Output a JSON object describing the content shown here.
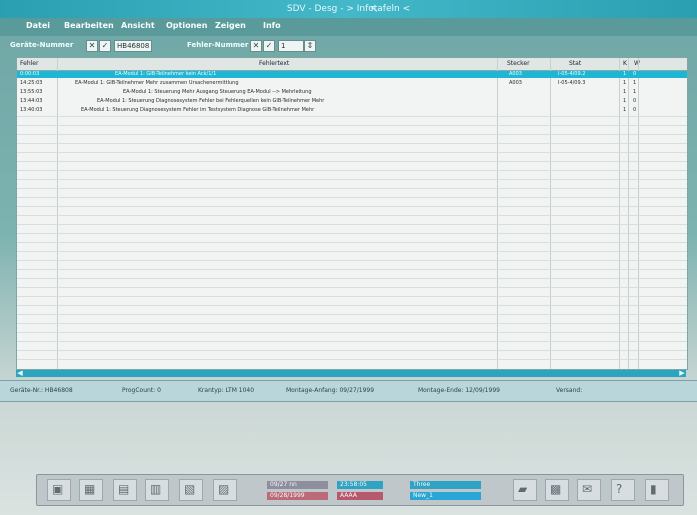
{
  "window": {
    "title": "SDV - Desg - > Infotafeln <"
  },
  "menu": [
    "Datei",
    "Bearbeiten",
    "Ansicht",
    "Optionen",
    "Zeigen",
    "Info"
  ],
  "toolbar": {
    "geraete_label": "Geräte-Nummer",
    "geraete_value": "HB46808",
    "fehler_label": "Fehler-Nummer",
    "fehler_value": "1"
  },
  "table": {
    "columns": [
      "Fehler",
      "Fehlertext",
      "Stecker",
      "Stat",
      "K",
      "W"
    ],
    "rows": [
      {
        "id": "0:00:03",
        "text": "EA-Modul 1: GIB-Teilnehmer kein Ack/1/1",
        "stecker": "A003",
        "stat": "I-05-4/09.2",
        "k": "1",
        "w": "0",
        "selected": true
      },
      {
        "id": "14:25:03",
        "text": "EA-Modul 1: GIB-Teilnehmer Mehr zusammen Ursachenermittlung",
        "stecker": "A003",
        "stat": "I-05-4/09.3",
        "k": "1",
        "w": "1",
        "selected": false
      },
      {
        "id": "13:55:03",
        "text": "EA-Modul 1: Steuerung Mehr Ausgang Steuerung EA-Modul --> Mehrleitung",
        "stecker": "",
        "stat": "",
        "k": "1",
        "w": "1",
        "selected": false
      },
      {
        "id": "13:44:03",
        "text": "EA-Modul 1: Steuerung Diagnosesystem Fehler bei Fehlerquellen kein GIB-Teilnehmer Mehr",
        "stecker": "",
        "stat": "",
        "k": "1",
        "w": "0",
        "selected": false
      },
      {
        "id": "13:40:03",
        "text": "EA-Modul 1: Steuerung Diagnosesystem Fehler im Testsystem Diagnose GIB-Teilnehmer Mehr",
        "stecker": "",
        "stat": "",
        "k": "1",
        "w": "0",
        "selected": false
      }
    ]
  },
  "status": {
    "geraete": "Geräte-Nr.: HB46808",
    "progcount": "ProgCount: 0",
    "kranttyp": "Krantyp: LTM 1040",
    "montage_anfang": "Montage-Anfang: 09/27/1999",
    "montage_ende": "Montage-Ende: 12/09/1999",
    "versand": "Versand:"
  },
  "taskbar": {
    "pills": [
      "09/27 nn",
      "23:58:05",
      "Three",
      "09/28/1999",
      "AAAA",
      "New_1"
    ]
  }
}
